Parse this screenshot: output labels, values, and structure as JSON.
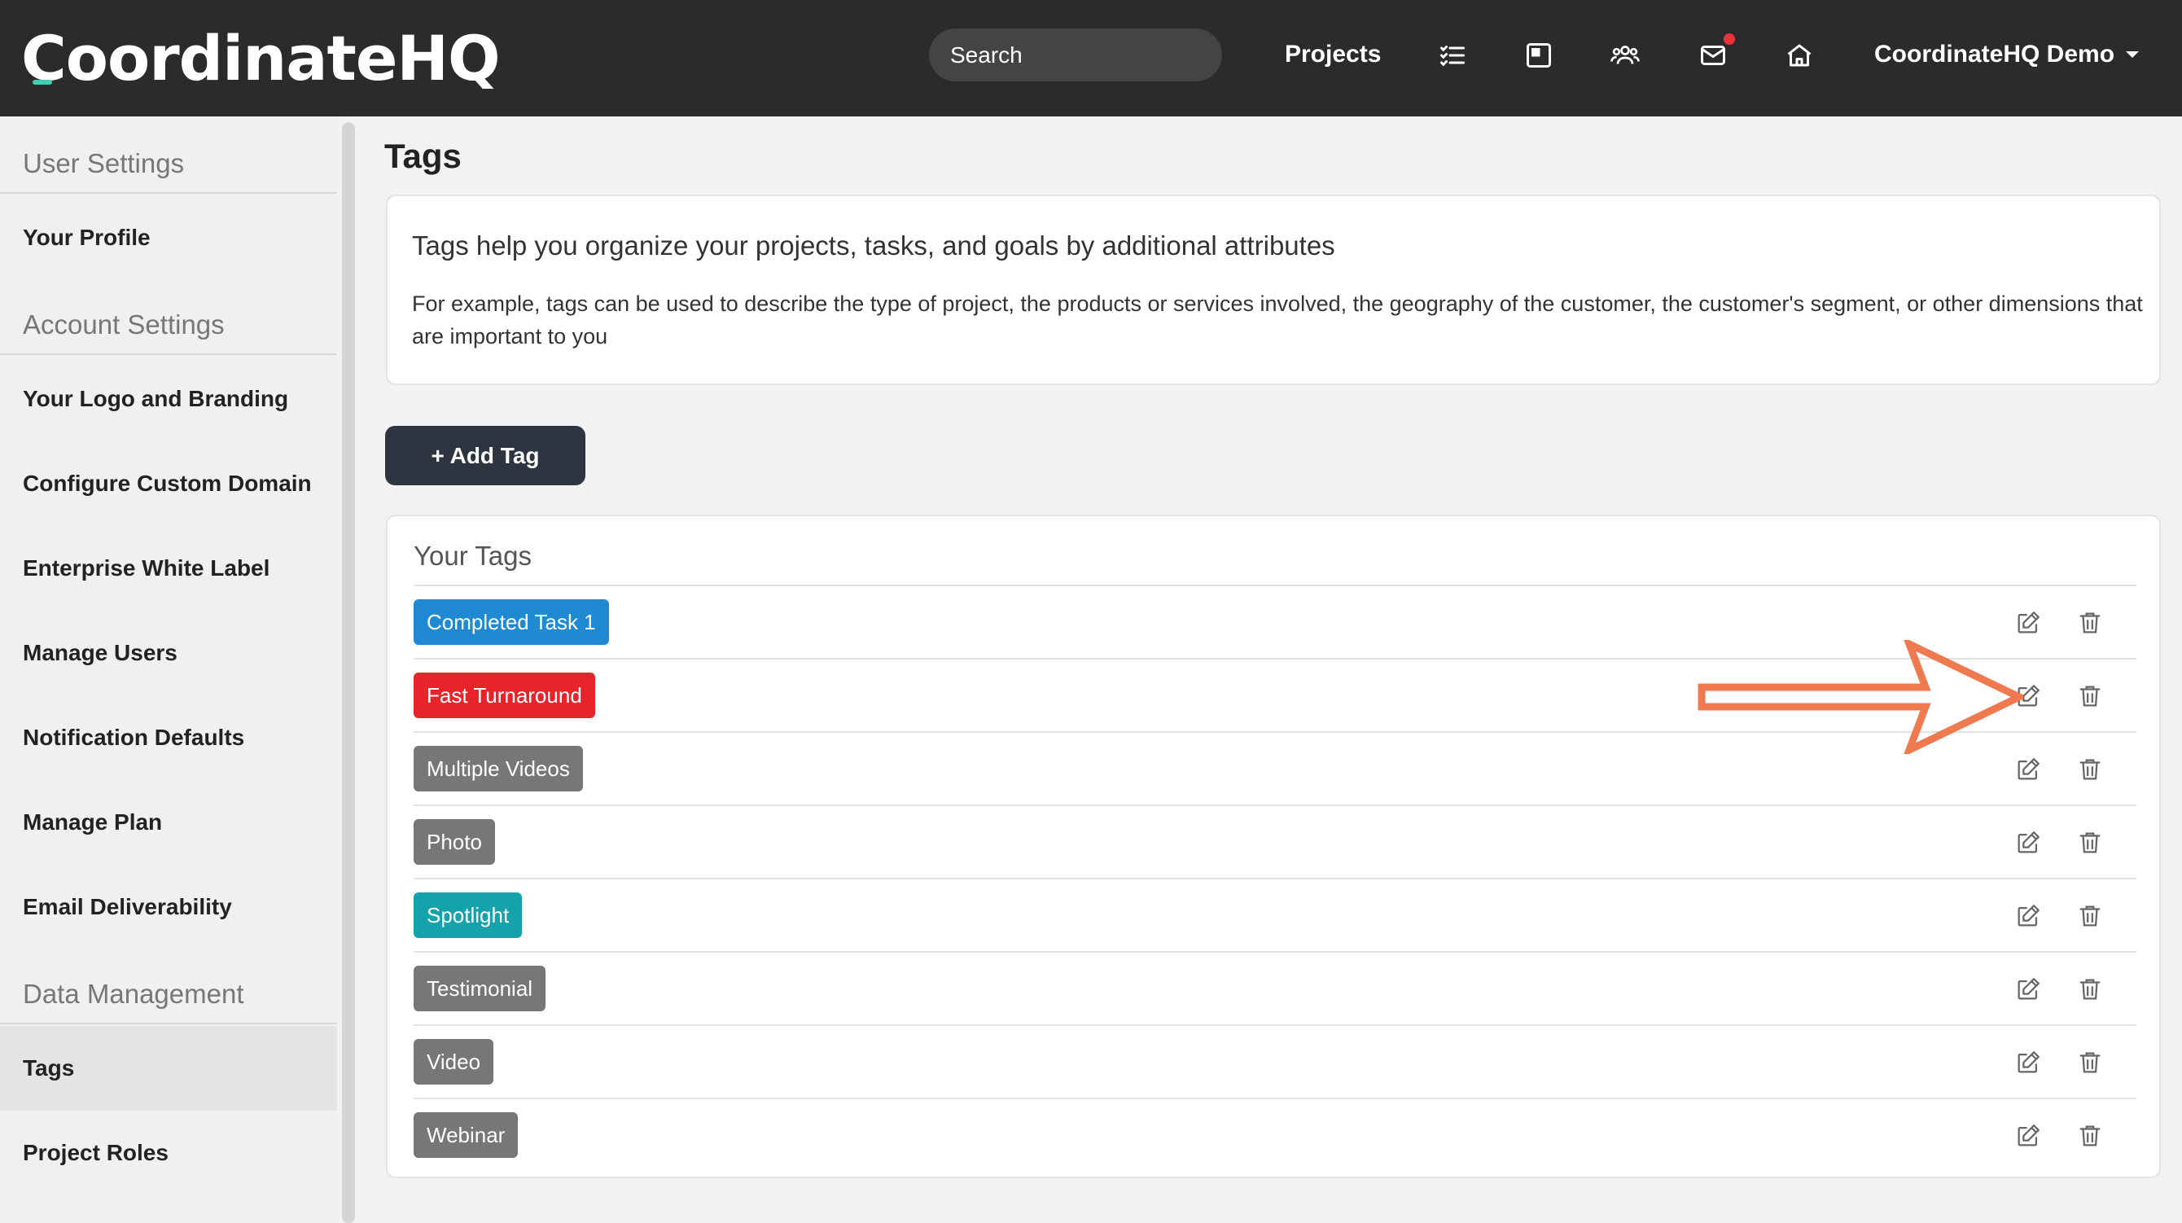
{
  "brand": {
    "name": "CoordinateHQ",
    "accent_color": "#3ccfb0"
  },
  "header": {
    "search_placeholder": "Search",
    "projects_label": "Projects",
    "icons": [
      "checklist-icon",
      "board-icon",
      "team-icon",
      "inbox-icon",
      "home-icon"
    ],
    "account_label": "CoordinateHQ Demo"
  },
  "sidebar": {
    "sections": [
      {
        "title": "User Settings",
        "items": [
          {
            "label": "Your Profile"
          }
        ]
      },
      {
        "title": "Account Settings",
        "items": [
          {
            "label": "Your Logo and Branding"
          },
          {
            "label": "Configure Custom Domain"
          },
          {
            "label": "Enterprise White Label"
          },
          {
            "label": "Manage Users"
          },
          {
            "label": "Notification Defaults"
          },
          {
            "label": "Manage Plan"
          },
          {
            "label": "Email Deliverability"
          }
        ]
      },
      {
        "title": "Data Management",
        "items": [
          {
            "label": "Tags",
            "active": true
          },
          {
            "label": "Project Roles"
          }
        ]
      }
    ]
  },
  "main": {
    "title": "Tags",
    "info": {
      "heading": "Tags help you organize your projects, tasks, and goals by additional attributes",
      "body": "For example, tags can be used to describe the type of project, the products or services involved, the geography of the customer, the customer's segment, or other dimensions that are important to you"
    },
    "add_button_label": "+ Add Tag",
    "tags_heading": "Your Tags",
    "tags": [
      {
        "label": "Completed Task 1",
        "color": "#1f8ad1"
      },
      {
        "label": "Fast Turnaround",
        "color": "#e8232a"
      },
      {
        "label": "Multiple Videos",
        "color": "#777777"
      },
      {
        "label": "Photo",
        "color": "#777777"
      },
      {
        "label": "Spotlight",
        "color": "#14a3aa"
      },
      {
        "label": "Testimonial",
        "color": "#777777"
      },
      {
        "label": "Video",
        "color": "#777777"
      },
      {
        "label": "Webinar",
        "color": "#777777"
      }
    ]
  },
  "annotation": {
    "arrow_color": "#ef7a50"
  }
}
